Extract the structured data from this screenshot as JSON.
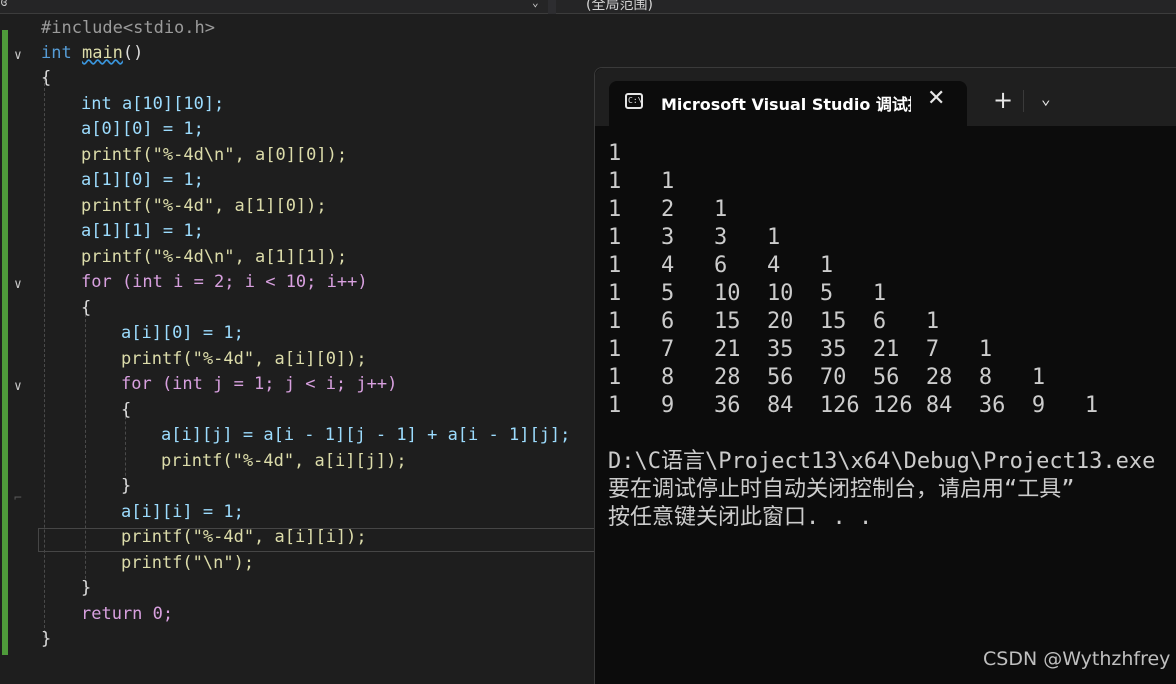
{
  "top": {
    "scope_label": "(全局范围)"
  },
  "code": {
    "l0": "#include<stdio.h>",
    "l1_kw": "int",
    "l1_fn": "main",
    "l1_rest": "()",
    "l2": "{",
    "l3": "int a[10][10];",
    "l4": "a[0][0] = 1;",
    "l5": "printf(\"%-4d\\n\", a[0][0]);",
    "l6": "a[1][0] = 1;",
    "l7": "printf(\"%-4d\", a[1][0]);",
    "l8": "a[1][1] = 1;",
    "l9": "printf(\"%-4d\\n\", a[1][1]);",
    "l10": "for (int i = 2; i < 10; i++)",
    "l11": "{",
    "l12": "a[i][0] = 1;",
    "l13": "printf(\"%-4d\", a[i][0]);",
    "l14": "for (int j = 1; j < i; j++)",
    "l15": "{",
    "l16": "a[i][j] = a[i - 1][j - 1] + a[i - 1][j];",
    "l17": "printf(\"%-4d\", a[i][j]);",
    "l18": "}",
    "l19": "a[i][i] = 1;",
    "l20": "printf(\"%-4d\", a[i][i]);",
    "l21": "printf(\"\\n\");",
    "l22": "}",
    "l23": "return 0;",
    "l24": "}"
  },
  "console": {
    "tab_title": "Microsoft Visual Studio 调试控制台",
    "close_glyph": "✕",
    "new_tab_glyph": "+",
    "dropdown_glyph": "⌄",
    "output": [
      "1",
      "1   1",
      "1   2   1",
      "1   3   3   1",
      "1   4   6   4   1",
      "1   5   10  10  5   1",
      "1   6   15  20  15  6   1",
      "1   7   21  35  35  21  7   1",
      "1   8   28  56  70  56  28  8   1",
      "1   9   36  84  126 126 84  36  9   1",
      "",
      "D:\\C语言\\Project13\\x64\\Debug\\Project13.exe",
      "要在调试停止时自动关闭控制台，请启用“工具”",
      "按任意键关闭此窗口. . ."
    ]
  },
  "watermark": "CSDN @Wythzhfrey"
}
